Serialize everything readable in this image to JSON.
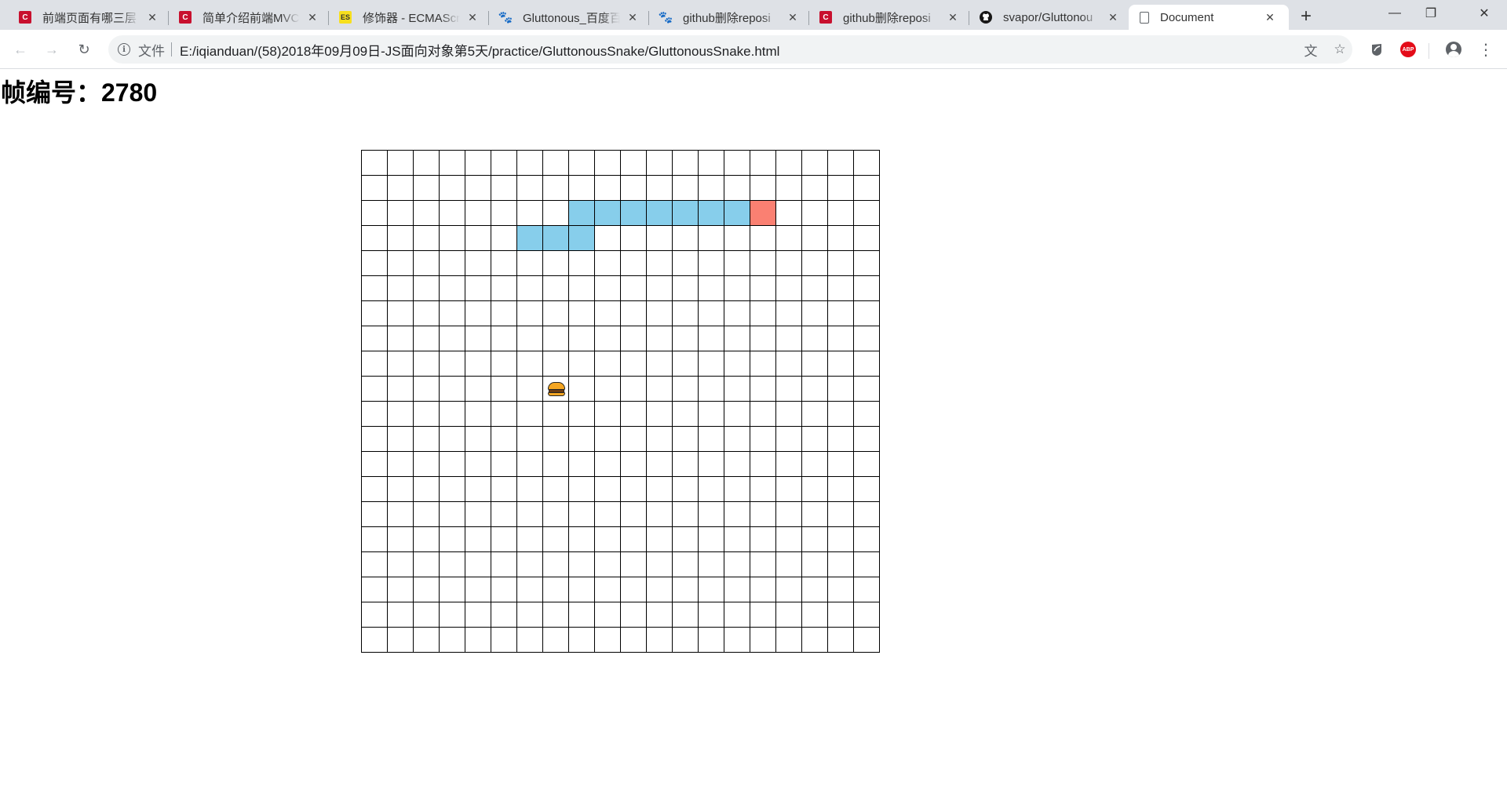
{
  "browser": {
    "tabs": [
      {
        "title": "前端页面有哪三层",
        "favicon": "csdn-icon",
        "active": false
      },
      {
        "title": "简单介绍前端MVC",
        "favicon": "csdn-icon",
        "active": false
      },
      {
        "title": "修饰器 - ECMAScr",
        "favicon": "es-icon",
        "active": false
      },
      {
        "title": "Gluttonous_百度百",
        "favicon": "baidu-icon",
        "active": false
      },
      {
        "title": "github删除reposi",
        "favicon": "baidu-icon",
        "active": false
      },
      {
        "title": "github删除reposi",
        "favicon": "csdn-icon",
        "active": false
      },
      {
        "title": "svapor/Gluttonou",
        "favicon": "github-icon",
        "active": false
      },
      {
        "title": "Document",
        "favicon": "document-icon",
        "active": true
      }
    ],
    "favicon_text": {
      "csdn": "C",
      "es": "ES",
      "baidu": "🐾"
    },
    "omnibox": {
      "scheme_label": "文件",
      "url": "E:/iqianduan/(58)2018年09月09日-JS面向对象第5天/practice/GluttonousSnake/GluttonousSnake.html"
    },
    "extensions": {
      "abp_label": "ABP"
    }
  },
  "page": {
    "heading": "帧编号：2780"
  },
  "game": {
    "rows": 20,
    "cols": 20,
    "snake": {
      "head": [
        2,
        15
      ],
      "body": [
        [
          2,
          14
        ],
        [
          2,
          13
        ],
        [
          2,
          12
        ],
        [
          2,
          11
        ],
        [
          2,
          10
        ],
        [
          2,
          9
        ],
        [
          2,
          8
        ],
        [
          3,
          8
        ],
        [
          3,
          7
        ],
        [
          3,
          6
        ]
      ],
      "colors": {
        "body": "#87ceeb",
        "head": "#fa8072"
      }
    },
    "food": {
      "row": 9,
      "col": 7,
      "icon": "burger-icon"
    }
  }
}
